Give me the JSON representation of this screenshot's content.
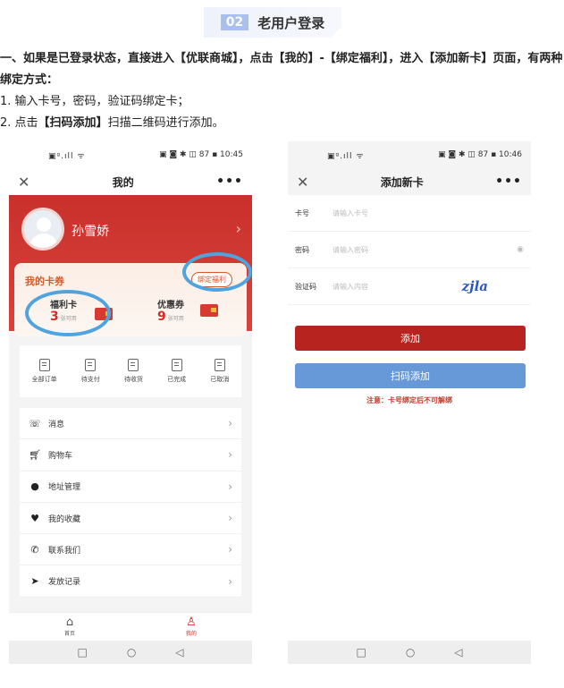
{
  "header": {
    "number": "02",
    "title": "老用户登录"
  },
  "intro": {
    "line1": "一、如果是已登录状态，直接进入【优联商城】，点击【我的】-【绑定福利】，进入【添加新卡】页面，有两种绑定方式：",
    "line2": "1. 输入卡号，密码，验证码绑定卡；",
    "line3_pre": "2. 点击",
    "line3_bold": "【扫码添加】",
    "line3_post": "扫描二维码进行添加。"
  },
  "phone1": {
    "status_left": "▣ᵍ.ıll ᯤ",
    "status_right": "▣ ◙ ✱ ◫ 87 ▪ 10:45",
    "title": "我的",
    "user_name": "孙雪娇",
    "card_section_title": "我的卡券",
    "bind_button": "绑定福利",
    "welfare_card_label": "福利卡",
    "welfare_card_count": "3",
    "welfare_card_unit": "张可用",
    "coupon_label": "优惠券",
    "coupon_count": "9",
    "coupon_unit": "张可用",
    "orders": [
      {
        "label": "全部订单"
      },
      {
        "label": "待支付"
      },
      {
        "label": "待收货"
      },
      {
        "label": "已完成"
      },
      {
        "label": "已取消"
      }
    ],
    "menu": [
      {
        "label": "消息",
        "icon": "message-icon"
      },
      {
        "label": "购物车",
        "icon": "cart-icon"
      },
      {
        "label": "地址管理",
        "icon": "location-icon"
      },
      {
        "label": "我的收藏",
        "icon": "heart-icon"
      },
      {
        "label": "联系我们",
        "icon": "phone-icon"
      },
      {
        "label": "发放记录",
        "icon": "send-icon"
      }
    ],
    "tabs": [
      {
        "label": "首页"
      },
      {
        "label": "我的"
      }
    ]
  },
  "phone2": {
    "status_left": "▣ᵍ.ıll ᯤ",
    "status_right": "▣ ◙ ✱ ◫ 87 ▪ 10:46",
    "title": "添加新卡",
    "card_no_label": "卡号",
    "card_no_placeholder": "请输入卡号",
    "password_label": "密码",
    "password_placeholder": "请输入密码",
    "captcha_label": "验证码",
    "captcha_placeholder": "请输入内容",
    "captcha_text": "zjla",
    "add_button": "添加",
    "scan_button": "扫码添加",
    "note": "注意：卡号绑定后不可解绑"
  },
  "colors": {
    "brand_red": "#c9302c",
    "scan_blue": "#6799d9",
    "highlight_ring": "#4fa3df"
  }
}
